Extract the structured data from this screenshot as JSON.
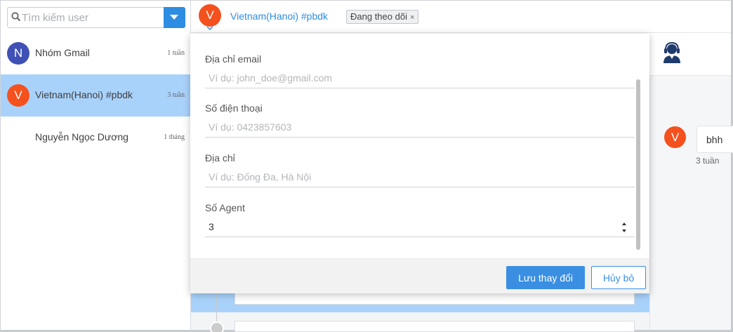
{
  "colors": {
    "accent": "#2d8de3",
    "active_row": "#a9d2fb",
    "avatar_orange": "#f4511e",
    "avatar_indigo": "#3f51b5"
  },
  "search": {
    "placeholder": "Tìm kiếm user",
    "icon": "search-icon",
    "dropdown_icon": "caret-down-icon"
  },
  "conversations": [
    {
      "avatar": "N",
      "name": "Nhóm Gmail",
      "time": "1 tuần"
    },
    {
      "avatar": "V",
      "name": "Vietnam(Hanoi) #pbdk",
      "time": "3 tuần"
    },
    {
      "avatar": "",
      "name": "Nguyễn Ngọc Dương",
      "time": "1 tháng"
    }
  ],
  "header": {
    "avatar": "V",
    "title": "Vietnam(Hanoi) #pbdk",
    "tag": "Đang theo dõi",
    "tag_close": "×"
  },
  "form": {
    "email": {
      "label": "Địa chỉ email",
      "placeholder": "Ví dụ: john_doe@gmail.com",
      "value": ""
    },
    "phone": {
      "label": "Số điện thoại",
      "placeholder": "Ví dụ: 0423857603",
      "value": ""
    },
    "address": {
      "label": "Địa chỉ",
      "placeholder": "Ví dụ: Đống Đa, Hà Nội",
      "value": ""
    },
    "agents": {
      "label": "Số Agent",
      "value": "3"
    },
    "save_label": "Lưu thay đổi",
    "cancel_label": "Hủy bỏ"
  },
  "right_panel": {
    "icon": "support-agent-icon",
    "message": {
      "avatar": "V",
      "text": "bhh",
      "time": "3 tuần"
    }
  }
}
